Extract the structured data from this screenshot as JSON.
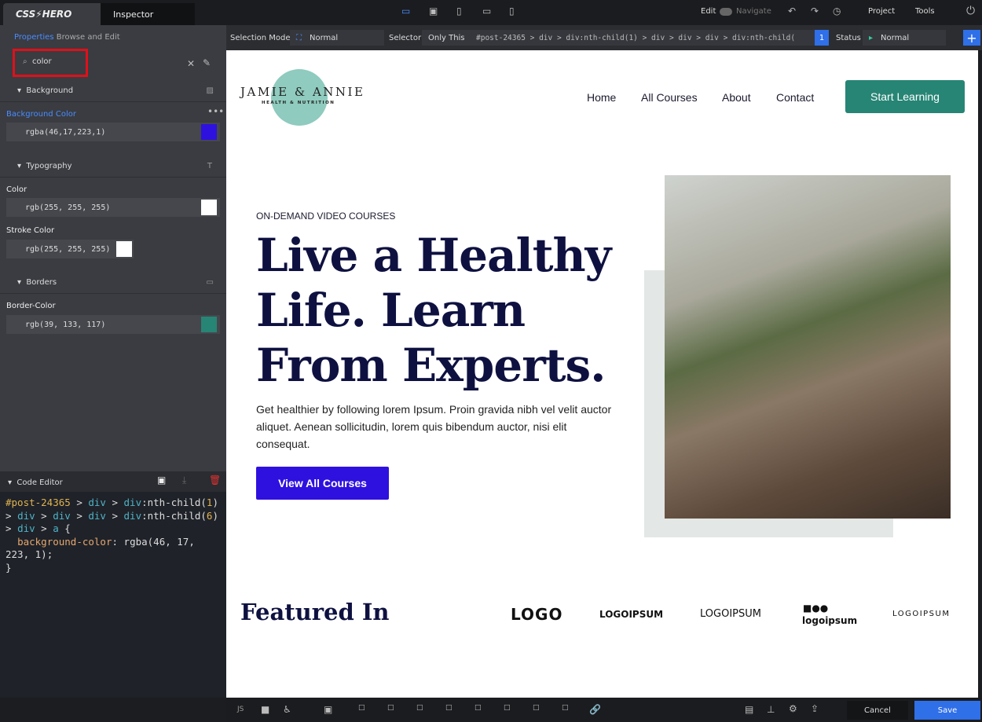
{
  "topbar": {
    "brand": "CSS⚡HERO",
    "inspector_tab": "Inspector",
    "edit": "Edit",
    "navigate": "Navigate",
    "project": "Project",
    "tools": "Tools"
  },
  "toolbar": {
    "selection_mode_label": "Selection Mode",
    "selection_mode_value": "Normal",
    "selector_label": "Selector",
    "only_this": "Only This",
    "selector_path": "#post-24365 > div > div:nth-child(1) > div > div > div > div:nth-child(",
    "match_count": "1",
    "status_label": "Status",
    "status_value": "Normal"
  },
  "left": {
    "properties": "Properties",
    "browse": "Browse and Edit",
    "search_value": "color",
    "sections": {
      "background": "Background",
      "typography": "Typography",
      "borders": "Borders"
    },
    "bg_color_label": "Background Color",
    "bg_color_value": "rgba(46,17,223,1)",
    "bg_color_swatch": "#2e11df",
    "color_label": "Color",
    "color_value": "rgb(255, 255, 255)",
    "stroke_label": "Stroke Color",
    "stroke_value": "rgb(255, 255, 255)",
    "border_label": "Border-Color",
    "border_value": "rgb(39, 133, 117)",
    "border_swatch": "#278575"
  },
  "code_editor": {
    "title": "Code Editor",
    "selector_id": "#post-24365",
    "rule_property": "background-color",
    "rule_value_fn": "rgba(46, 17, 223, 1)"
  },
  "site": {
    "logo_title": "JAMIE & ANNIE",
    "logo_sub": "HEALTH & NUTRITION",
    "nav": [
      "Home",
      "All Courses",
      "About",
      "Contact"
    ],
    "cta": "Start Learning",
    "eyebrow": "ON-DEMAND VIDEO COURSES",
    "headline": [
      "Live a Healthy",
      "Life. Learn",
      "From Experts."
    ],
    "body": "Get healthier by following lorem Ipsum. Proin gravida nibh vel velit auctor aliquet. Aenean sollicitudin, lorem quis bibendum auctor, nisi elit consequat.",
    "button": "View All Courses",
    "featured": "Featured In",
    "logos": [
      "LOGO",
      "LOGOIPSUM",
      "LOGOIPSUM",
      "logoipsum",
      "LOGOIPSUM"
    ]
  },
  "bottombar": {
    "js": "JS",
    "cancel": "Cancel",
    "save": "Save"
  }
}
